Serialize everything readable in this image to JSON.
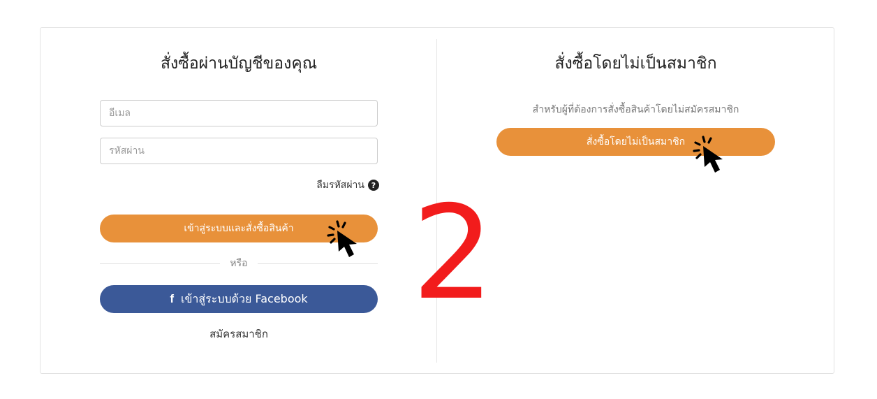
{
  "member": {
    "title": "สั่งซื้อผ่านบัญชีของคุณ",
    "email_placeholder": "อีเมล",
    "password_placeholder": "รหัสผ่าน",
    "forgot_label": "ลืมรหัสผ่าน",
    "login_button": "เข้าสู่ระบบและสั่งซื้อสินค้า",
    "or_label": "หรือ",
    "facebook_button": "เข้าสู่ระบบด้วย Facebook",
    "facebook_icon_glyph": "f",
    "register_link": "สมัครสมาชิก"
  },
  "guest": {
    "title": "สั่งซื้อโดยไม่เป็นสมาชิก",
    "description": "สำหรับผู้ที่ต้องการสั่งซื้อสินค้าโดยไม่สมัครสมาชิก",
    "button": "สั่งซื้อโดยไม่เป็นสมาชิก"
  },
  "annotation": {
    "step_number": "2"
  },
  "icons": [
    "help-circle-icon",
    "facebook-icon",
    "click-cursor-icon"
  ],
  "colors": {
    "primary_orange": "#e8913a",
    "facebook_blue": "#3b5998",
    "step_red": "#f21c1c"
  }
}
